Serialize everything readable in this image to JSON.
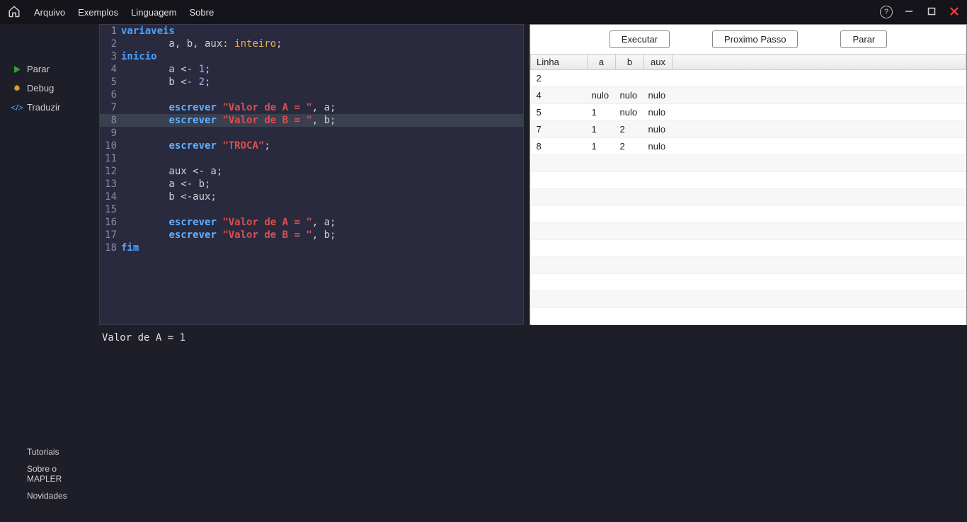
{
  "menu": {
    "arquivo": "Arquivo",
    "exemplos": "Exemplos",
    "linguagem": "Linguagem",
    "sobre": "Sobre"
  },
  "sidebar": {
    "parar": "Parar",
    "debug": "Debug",
    "traduzir": "Traduzir"
  },
  "bottomLinks": {
    "tutoriais": "Tutoriais",
    "sobreMapler": "Sobre o MAPLER",
    "novidades": "Novidades"
  },
  "editor": {
    "highlightedLine": 8,
    "lines": [
      {
        "n": 1,
        "tokens": [
          {
            "t": "variaveis",
            "c": "kw-blue"
          }
        ]
      },
      {
        "n": 2,
        "tokens": [
          {
            "t": "        a, b, aux: ",
            "c": "ident"
          },
          {
            "t": "inteiro",
            "c": "type"
          },
          {
            "t": ";",
            "c": "ident"
          }
        ]
      },
      {
        "n": 3,
        "tokens": [
          {
            "t": "inicio",
            "c": "kw-blue"
          }
        ]
      },
      {
        "n": 4,
        "tokens": [
          {
            "t": "        a <- ",
            "c": "ident"
          },
          {
            "t": "1",
            "c": "num-lit"
          },
          {
            "t": ";",
            "c": "ident"
          }
        ]
      },
      {
        "n": 5,
        "tokens": [
          {
            "t": "        b <- ",
            "c": "ident"
          },
          {
            "t": "2",
            "c": "num-lit"
          },
          {
            "t": ";",
            "c": "ident"
          }
        ]
      },
      {
        "n": 6,
        "tokens": []
      },
      {
        "n": 7,
        "tokens": [
          {
            "t": "        ",
            "c": "ident"
          },
          {
            "t": "escrever",
            "c": "kw-func"
          },
          {
            "t": " ",
            "c": "ident"
          },
          {
            "t": "\"Valor de A = \"",
            "c": "str-lit"
          },
          {
            "t": ", a;",
            "c": "ident"
          }
        ]
      },
      {
        "n": 8,
        "tokens": [
          {
            "t": "        ",
            "c": "ident"
          },
          {
            "t": "escrever",
            "c": "kw-func"
          },
          {
            "t": " ",
            "c": "ident"
          },
          {
            "t": "\"Valor de B = \"",
            "c": "str-lit"
          },
          {
            "t": ", b;",
            "c": "ident"
          }
        ]
      },
      {
        "n": 9,
        "tokens": []
      },
      {
        "n": 10,
        "tokens": [
          {
            "t": "        ",
            "c": "ident"
          },
          {
            "t": "escrever",
            "c": "kw-func"
          },
          {
            "t": " ",
            "c": "ident"
          },
          {
            "t": "\"TROCA\"",
            "c": "str-lit"
          },
          {
            "t": ";",
            "c": "ident"
          }
        ]
      },
      {
        "n": 11,
        "tokens": []
      },
      {
        "n": 12,
        "tokens": [
          {
            "t": "        aux <- a;",
            "c": "ident"
          }
        ]
      },
      {
        "n": 13,
        "tokens": [
          {
            "t": "        a <- b;",
            "c": "ident"
          }
        ]
      },
      {
        "n": 14,
        "tokens": [
          {
            "t": "        b <-aux;",
            "c": "ident"
          }
        ]
      },
      {
        "n": 15,
        "tokens": []
      },
      {
        "n": 16,
        "tokens": [
          {
            "t": "        ",
            "c": "ident"
          },
          {
            "t": "escrever",
            "c": "kw-func"
          },
          {
            "t": " ",
            "c": "ident"
          },
          {
            "t": "\"Valor de A = \"",
            "c": "str-lit"
          },
          {
            "t": ", a;",
            "c": "ident"
          }
        ]
      },
      {
        "n": 17,
        "tokens": [
          {
            "t": "        ",
            "c": "ident"
          },
          {
            "t": "escrever",
            "c": "kw-func"
          },
          {
            "t": " ",
            "c": "ident"
          },
          {
            "t": "\"Valor de B = \"",
            "c": "str-lit"
          },
          {
            "t": ", b;",
            "c": "ident"
          }
        ]
      },
      {
        "n": 18,
        "tokens": [
          {
            "t": "fim",
            "c": "kw-blue"
          }
        ]
      }
    ]
  },
  "debugToolbar": {
    "executar": "Executar",
    "proximoPasso": "Proximo Passo",
    "parar": "Parar"
  },
  "varTable": {
    "headers": {
      "linha": "Linha",
      "a": "a",
      "b": "b",
      "aux": "aux"
    },
    "rows": [
      {
        "linha": "2",
        "a": "",
        "b": "",
        "aux": ""
      },
      {
        "linha": "4",
        "a": "nulo",
        "b": "nulo",
        "aux": "nulo"
      },
      {
        "linha": "5",
        "a": "1",
        "b": "nulo",
        "aux": "nulo"
      },
      {
        "linha": "7",
        "a": "1",
        "b": "2",
        "aux": "nulo"
      },
      {
        "linha": "8",
        "a": "1",
        "b": "2",
        "aux": "nulo"
      }
    ],
    "blankRows": 10
  },
  "console": {
    "output": "Valor de A = 1"
  }
}
